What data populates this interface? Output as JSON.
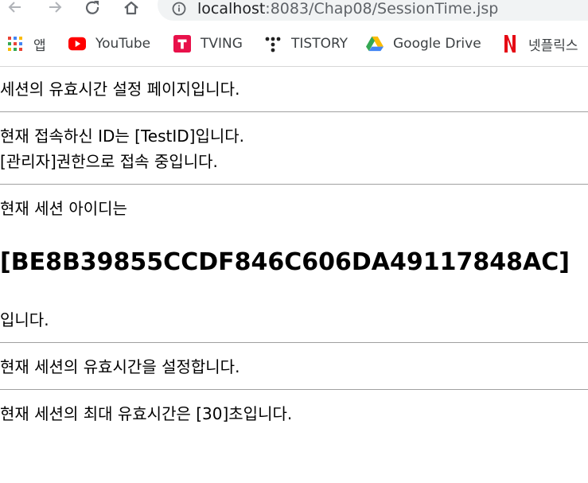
{
  "browser": {
    "url_host": "localhost",
    "url_rest": ":8083/Chap08/SessionTime.jsp",
    "bookmarks": [
      {
        "label": "앱",
        "icon": "apps-grid-icon"
      },
      {
        "label": "YouTube",
        "icon": "youtube-icon"
      },
      {
        "label": "TVING",
        "icon": "tving-icon"
      },
      {
        "label": "TISTORY",
        "icon": "tistory-icon"
      },
      {
        "label": "Google Drive",
        "icon": "google-drive-icon"
      },
      {
        "label": "넷플릭스",
        "icon": "netflix-icon"
      }
    ]
  },
  "page": {
    "heading": "세션의 유효시간 설정 페이지입니다.",
    "user_line": "현재 접속하신 ID는 [TestID]입니다.",
    "role_line": "[관리자]권한으로 접속 중입니다.",
    "session_intro": "현재 세션 아이디는",
    "session_id": "[BE8B39855CCDF846C606DA49117848AC]",
    "session_outro": "입니다.",
    "timeout_set": "현재 세션의 유효시간을 설정합니다.",
    "timeout_max": "현재 세션의 최대 유효시간은 [30]초입니다."
  }
}
